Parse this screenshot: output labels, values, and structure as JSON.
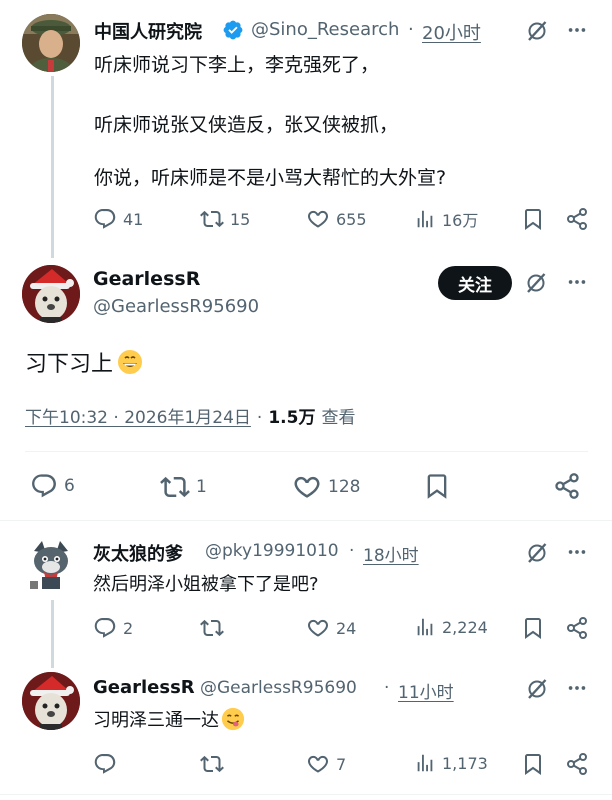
{
  "post1": {
    "name": "中国人研究院",
    "handle": "@Sino_Research",
    "separator": "·",
    "time": "20小时",
    "paragraphs": [
      "听床师说习下李上，李克强死了，",
      "听床师说张又侠造反，张又侠被抓，",
      "你说，听床师是不是小骂大帮忙的大外宣?"
    ],
    "replies": "41",
    "reposts": "15",
    "likes": "655",
    "views": "16万"
  },
  "post2": {
    "name": "GearlessR",
    "handle": "@GearlessR95690",
    "follow_label": "关注",
    "text": "习下习上",
    "timestamp": "下午10:32 · 2026年1月24日",
    "dot": "·",
    "views_count": "1.5万",
    "views_label": "查看",
    "replies": "6",
    "reposts": "1",
    "likes": "128"
  },
  "reply1": {
    "name": "灰太狼的爹",
    "handle": "@pky19991010",
    "separator": "·",
    "time": "18小时",
    "text": "然后明泽小姐被拿下了是吧?",
    "replies": "2",
    "reposts": "",
    "likes": "24",
    "views": "2,224"
  },
  "reply2": {
    "name": "GearlessR",
    "handle": "@GearlessR95690",
    "separator": "·",
    "time": "11小时",
    "text": "习明泽三通一达",
    "replies": "",
    "reposts": "",
    "likes": "7",
    "views": "1,173"
  },
  "colors": {
    "text": "#0f1419",
    "secondary": "#536471",
    "verified": "#1d9bf0",
    "divider": "#eff3f4"
  },
  "icons": [
    "verified-badge-icon",
    "grok-icon",
    "more-icon",
    "reply-icon",
    "repost-icon",
    "like-icon",
    "views-icon",
    "bookmark-icon",
    "share-icon",
    "grin-emoji-icon",
    "yum-emoji-icon"
  ]
}
